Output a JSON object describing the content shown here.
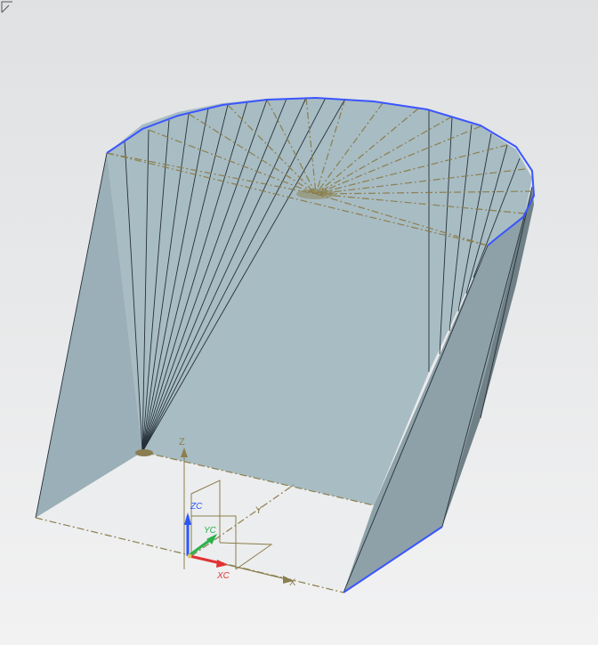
{
  "viewport": {
    "colors": {
      "background_top": "#dfe1e3",
      "background_bottom": "#f2f2f3",
      "face_main": "#a7bbc2",
      "face_dark": "#75858b",
      "edge_blue": "#3a55ff",
      "dashed_line": "#8b7f4e",
      "edge_dark": "#26313a"
    },
    "model": {
      "description_icon": "ruled-surface-model"
    },
    "triad": {
      "zc_label": "ZC",
      "yc_label": "YC",
      "xc_label": "XC",
      "z_label": "Z",
      "y_label": "Y",
      "x_label": "X",
      "colors": {
        "zc": "#2a56ff",
        "yc": "#2bb34a",
        "xc": "#e23232",
        "wcs": "#8b7f4e"
      }
    },
    "corner_icon": "view-corner-icon"
  }
}
